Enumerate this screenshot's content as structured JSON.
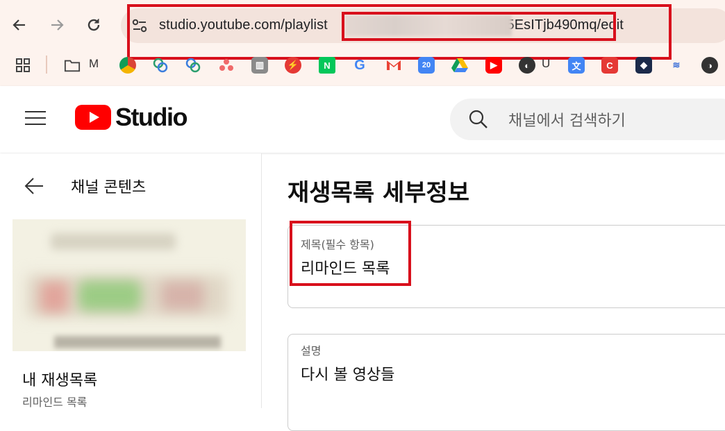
{
  "browser": {
    "url_prefix": "studio.youtube.com/playlist",
    "url_suffix": "G5EsITjb490mq/edit",
    "bookmarks": [
      {
        "label": "M",
        "icon": "folder-icon"
      },
      {
        "label": "U",
        "icon": "globe-icon"
      }
    ]
  },
  "header": {
    "logo_text": "Studio",
    "search_placeholder": "채널에서 검색하기"
  },
  "sidebar": {
    "back_label": "채널 콘텐츠",
    "playlist_title": "내 재생목록",
    "playlist_subtitle": "리마인드 목록"
  },
  "main": {
    "page_title": "재생목록 세부정보",
    "title_field": {
      "label": "제목(필수 항목)",
      "value": "리마인드 목록"
    },
    "description_field": {
      "label": "설명",
      "value": "다시 볼 영상들"
    }
  },
  "colors": {
    "brand_red": "#ff0000",
    "highlight_red": "#d8101c"
  }
}
